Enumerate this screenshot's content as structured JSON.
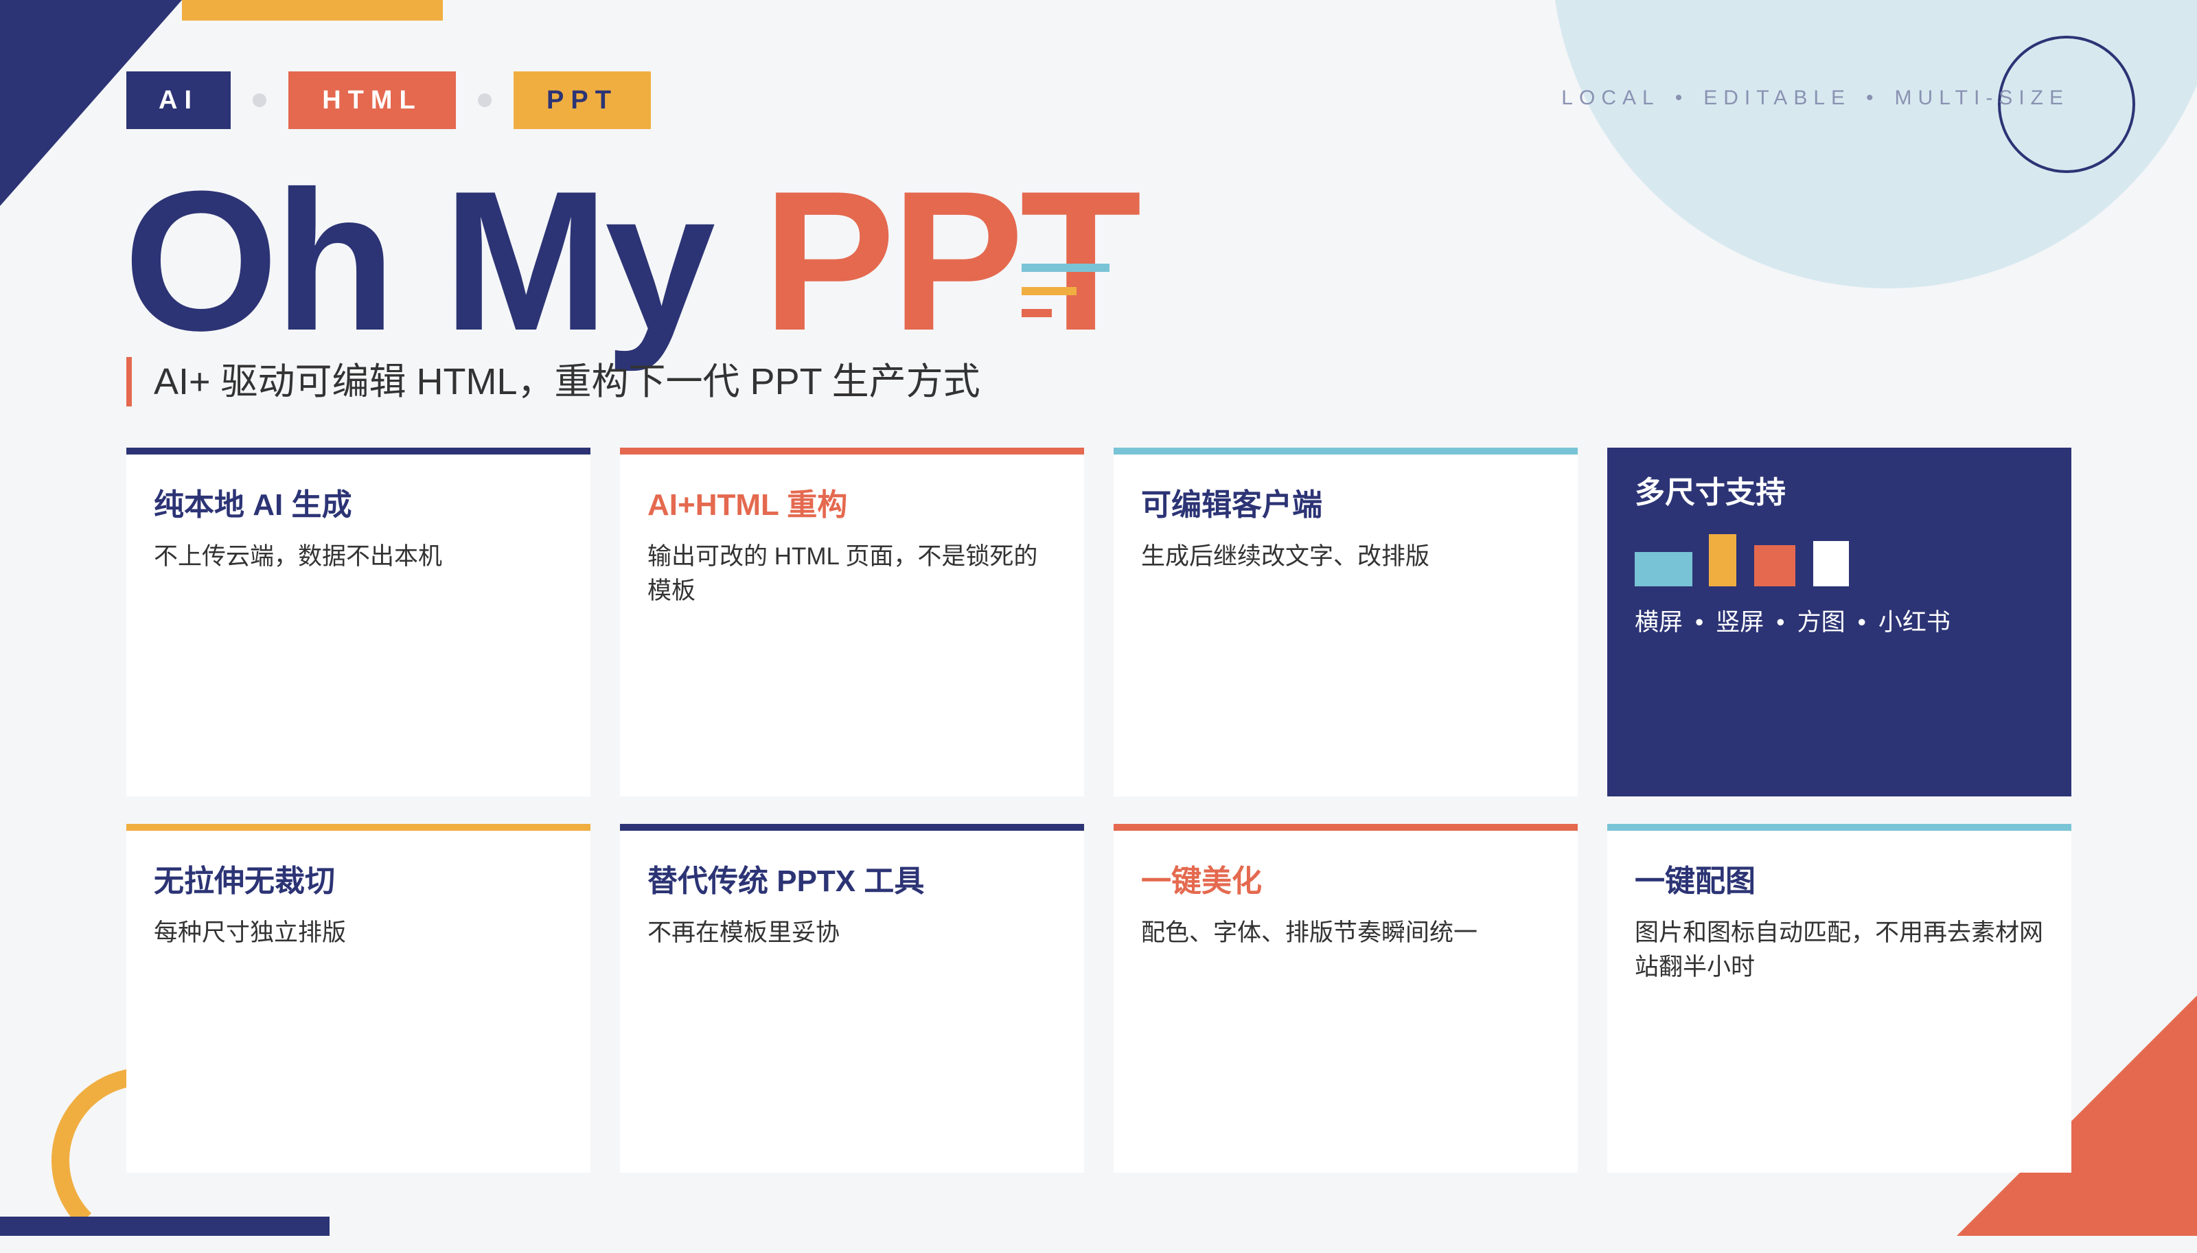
{
  "tags": [
    "AI",
    "HTML",
    "PPT"
  ],
  "top_right": [
    "LOCAL",
    "EDITABLE",
    "MULTI-SIZE"
  ],
  "separator": "•",
  "headline": {
    "part1": "Oh My",
    "part2": "PPT"
  },
  "subtitle": "AI+ 驱动可编辑 HTML，重构下一代 PPT 生产方式",
  "cards": [
    {
      "title": "纯本地 AI 生成",
      "desc": "不上传云端，数据不出本机",
      "accent": "#2c3475"
    },
    {
      "title": "AI+HTML 重构",
      "desc": "输出可改的 HTML 页面，不是锁死的模板",
      "accent": "#e4694f"
    },
    {
      "title": "可编辑客户端",
      "desc": "生成后继续改文字、改排版",
      "accent": "#79c3d6"
    },
    {
      "title": "多尺寸支持",
      "sizes": [
        "横屏",
        "竖屏",
        "方图",
        "小红书"
      ],
      "accent": "#2c3475"
    },
    {
      "title": "无拉伸无裁切",
      "desc": "每种尺寸独立排版",
      "accent": "#f0ae41"
    },
    {
      "title": "替代传统 PPTX 工具",
      "desc": "不再在模板里妥协",
      "accent": "#2c3475"
    },
    {
      "title": "一键美化",
      "desc": "配色、字体、排版节奏瞬间统一",
      "accent": "#e4694f"
    },
    {
      "title": "一键配图",
      "desc": "图片和图标自动匹配，不用再去素材网站翻半小时",
      "accent": "#79c3d6"
    }
  ],
  "colors": {
    "navy": "#2c3475",
    "coral": "#e4694f",
    "yellow": "#f0ae41",
    "teal": "#79c3d6",
    "background": "#f5f6f8"
  }
}
